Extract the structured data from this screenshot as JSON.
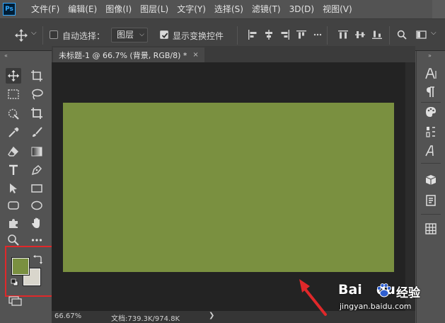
{
  "app": {
    "logo": "Ps"
  },
  "menu": {
    "items": [
      "文件(F)",
      "编辑(E)",
      "图像(I)",
      "图层(L)",
      "文字(Y)",
      "选择(S)",
      "滤镜(T)",
      "3D(D)",
      "视图(V)"
    ]
  },
  "options": {
    "auto_select_label": "自动选择：",
    "auto_select_checked": false,
    "layer_select_value": "图层",
    "show_transform_label": "显示变换控件",
    "show_transform_checked": true
  },
  "document": {
    "tab_title": "未标题-1 @ 66.7% (背景, RGB/8) *",
    "tab_close": "×",
    "zoom": "66.67%",
    "doc_size": "文档:739.3K/974.8K",
    "status_arrow": "❯",
    "canvas_color": "#7a9040"
  },
  "colors": {
    "foreground": "#7a9040",
    "background": "#d9d6cc",
    "highlight": "#e0282a",
    "accent_arrow": "#e0282a"
  },
  "tools": [
    "move-tool",
    "artboard-tool",
    "marquee-tool",
    "lasso-tool",
    "quick-select-tool",
    "crop-tool",
    "eyedropper-tool",
    "brush-tool",
    "eraser-tool",
    "gradient-tool",
    "type-tool",
    "pen-tool",
    "path-select-tool",
    "rectangle-tool",
    "rounded-rect-tool",
    "ellipse-tool",
    "puzzle-tool",
    "hand-tool",
    "zoom-tool",
    "more-tools"
  ],
  "right_panel": [
    "character-icon",
    "paragraph-icon",
    "swatches-icon",
    "adjust-icon",
    "glyphs-icon",
    "3d-icon",
    "libraries-icon",
    "grid-icon"
  ],
  "watermark": {
    "brand": "Bai",
    "brand2": "du",
    "cn": "经验",
    "url": "jingyan.baidu.com"
  }
}
